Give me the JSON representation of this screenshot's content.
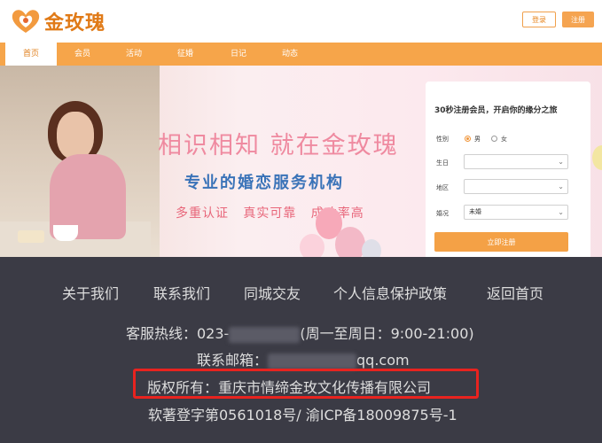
{
  "header": {
    "logo_text": "金玫瑰",
    "login_label": "登录",
    "register_label": "注册"
  },
  "nav": {
    "items": [
      "首页",
      "会员",
      "活动",
      "征婚",
      "日记",
      "动态"
    ],
    "active_index": 0
  },
  "banner": {
    "slogan_main": "相识相知 就在金玫瑰",
    "slogan_sub": "专业的婚恋服务机构",
    "slogan_tags": "多重认证   真实可靠   成功率高"
  },
  "form": {
    "title": "30秒注册会员，开启你的缘分之旅",
    "gender_label": "性别",
    "gender_male": "男",
    "gender_female": "女",
    "gender_selected": "男",
    "birthday_label": "生日",
    "birthday_value": "",
    "region_label": "地区",
    "region_value": "",
    "marital_label": "婚况",
    "marital_value": "未婚",
    "submit_label": "立即注册"
  },
  "footer": {
    "links": [
      "关于我们",
      "联系我们",
      "同城交友",
      "个人信息保护政策",
      "返回首页"
    ],
    "hotline_prefix": "客服热线：023-",
    "hotline_suffix": "(周一至周日：9:00-21:00)",
    "email_prefix": "联系邮箱：",
    "email_suffix": "qq.com",
    "copyright": "版权所有：重庆市情缔金玫文化传播有限公司",
    "registration": "软著登字第0561018号/ 渝ICP备18009875号-1"
  },
  "colors": {
    "brand_orange": "#f6a54a",
    "footer_bg": "#3b3b45",
    "highlight_red": "#e8231f"
  }
}
